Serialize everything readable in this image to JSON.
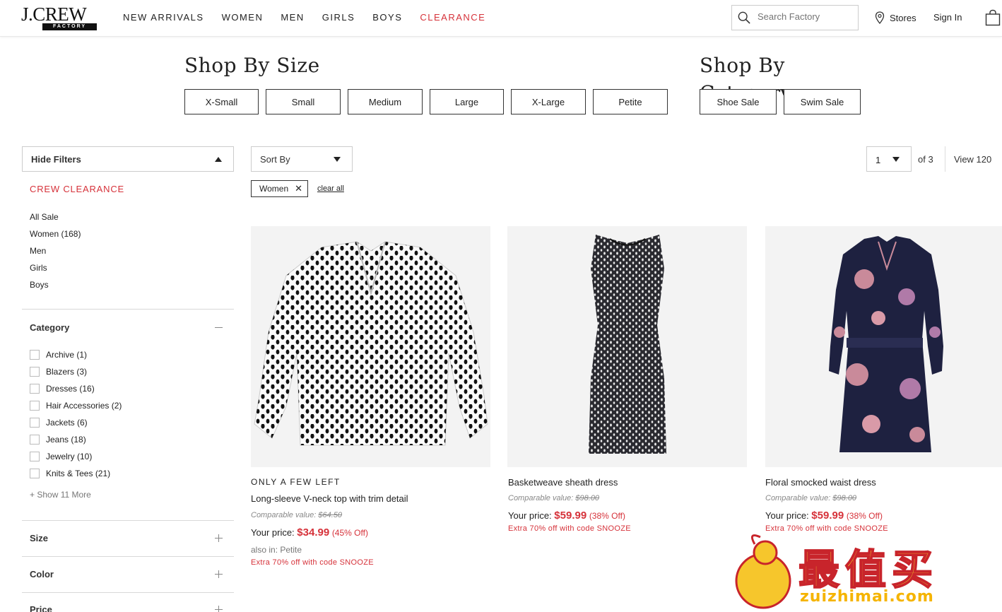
{
  "header": {
    "logo_text": "J.CREW",
    "logo_sub": "FACTORY",
    "nav": [
      "NEW ARRIVALS",
      "WOMEN",
      "MEN",
      "GIRLS",
      "BOYS",
      "CLEARANCE"
    ],
    "search_placeholder": "Search Factory",
    "stores": "Stores",
    "sign_in": "Sign In"
  },
  "shop_by_size": {
    "title": "Shop By Size",
    "sizes": [
      "X-Small",
      "Small",
      "Medium",
      "Large",
      "X-Large",
      "Petite"
    ]
  },
  "shop_by_category": {
    "title": "Shop By",
    "title_overflow": "Category",
    "categories": [
      "Shoe Sale",
      "Swim Sale"
    ]
  },
  "sidebar": {
    "hide_filters": "Hide Filters",
    "section_title": "CREW CLEARANCE",
    "links": [
      "All Sale",
      "Women (168)",
      "Men",
      "Girls",
      "Boys"
    ],
    "category_head": "Category",
    "category_items": [
      "Archive (1)",
      "Blazers (3)",
      "Dresses (16)",
      "Hair Accessories (2)",
      "Jackets (6)",
      "Jeans (18)",
      "Jewelry (10)",
      "Knits & Tees (21)"
    ],
    "show_more": "+ Show 11 More",
    "size_head": "Size",
    "color_head": "Color",
    "price_head": "Price"
  },
  "toolbar": {
    "sort_by": "Sort By",
    "page": "1",
    "of_pages": "of 3",
    "view": "View 120",
    "chip": "Women",
    "clear_all": "clear all"
  },
  "products": [
    {
      "badge": "ONLY A FEW LEFT",
      "name": "Long-sleeve V-neck top with trim detail",
      "comp_label": "Comparable value:",
      "comp_value": "$64.50",
      "price_label": "Your price:",
      "price": "$34.99",
      "off": "(45% Off)",
      "also": "also in: Petite",
      "extra": "Extra 70% off with code SNOOZE"
    },
    {
      "badge": "",
      "name": "Basketweave sheath dress",
      "comp_label": "Comparable value:",
      "comp_value": "$98.00",
      "price_label": "Your price:",
      "price": "$59.99",
      "off": "(38% Off)",
      "also": "",
      "extra": "Extra 70% off with code SNOOZE"
    },
    {
      "badge": "",
      "name": "Floral smocked waist dress",
      "comp_label": "Comparable value:",
      "comp_value": "$98.00",
      "price_label": "Your price:",
      "price": "$59.99",
      "off": "(38% Off)",
      "also": "",
      "extra": "Extra 70% off with code SNOOZE"
    }
  ],
  "watermark": {
    "text": "最值买",
    "url": "zuizhimai.com"
  },
  "colors": {
    "accent_red": "#d6323a",
    "watermark_yellow": "#f6c62c"
  }
}
